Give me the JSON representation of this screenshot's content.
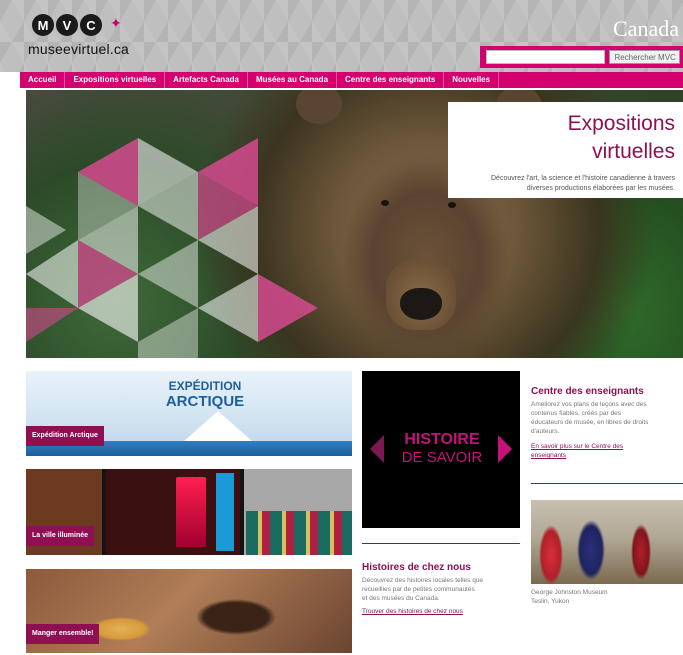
{
  "header": {
    "logo_letters": [
      "M",
      "V",
      "C"
    ],
    "logo_text": "museevirtuel.ca",
    "wordmark": "Canada",
    "search": {
      "placeholder": "",
      "button_label": "Rechercher MVC"
    }
  },
  "nav": {
    "items": [
      {
        "label": "Accueil"
      },
      {
        "label": "Expositions virtuelles"
      },
      {
        "label": "Artefacts Canada"
      },
      {
        "label": "Musées au Canada"
      },
      {
        "label": "Centre des enseignants"
      },
      {
        "label": "Nouvelles"
      }
    ]
  },
  "hero": {
    "title_line1": "Expositions",
    "title_line2": "virtuelles",
    "description_line1": "Découvrez l'art, la science et l'histoire canadienne à travers",
    "description_line2": "diverses productions élaborées par les musées."
  },
  "tiles": {
    "arctic": {
      "title_line1": "EXPÉDITION",
      "title_line2": "ARCTIQUE",
      "label": "Expédition Arctique"
    },
    "city": {
      "label": "La ville illuminée"
    },
    "food": {
      "label": "Manger ensemble!"
    }
  },
  "histoire": {
    "line1": "HISTOIRE",
    "line2": "DE SAVOIR",
    "section_title": "Histoires de chez nous",
    "body_line1": "Découvrez des histoires locales telles que",
    "body_line2": "recueillies par de petites communautés",
    "body_line3": "et des musées du Canada.",
    "link": "Trouver des histoires de chez nous"
  },
  "teachers": {
    "title": "Centre des enseignants",
    "body_line1": "Améliorez vos plans de leçons avec des",
    "body_line2": "contenus fiables, créés par des",
    "body_line3": "éducateurs de musée, en libres de droits",
    "body_line4": "d'auteurs.",
    "link_line1": "En savoir plus sur le Centre des",
    "link_line2": "enseignants"
  },
  "museum": {
    "caption_line1": "George Johnston Museum",
    "caption_line2": "Teslin, Yukon"
  },
  "colors": {
    "brand_magenta": "#d4006f",
    "brand_dark": "#8e1052"
  }
}
